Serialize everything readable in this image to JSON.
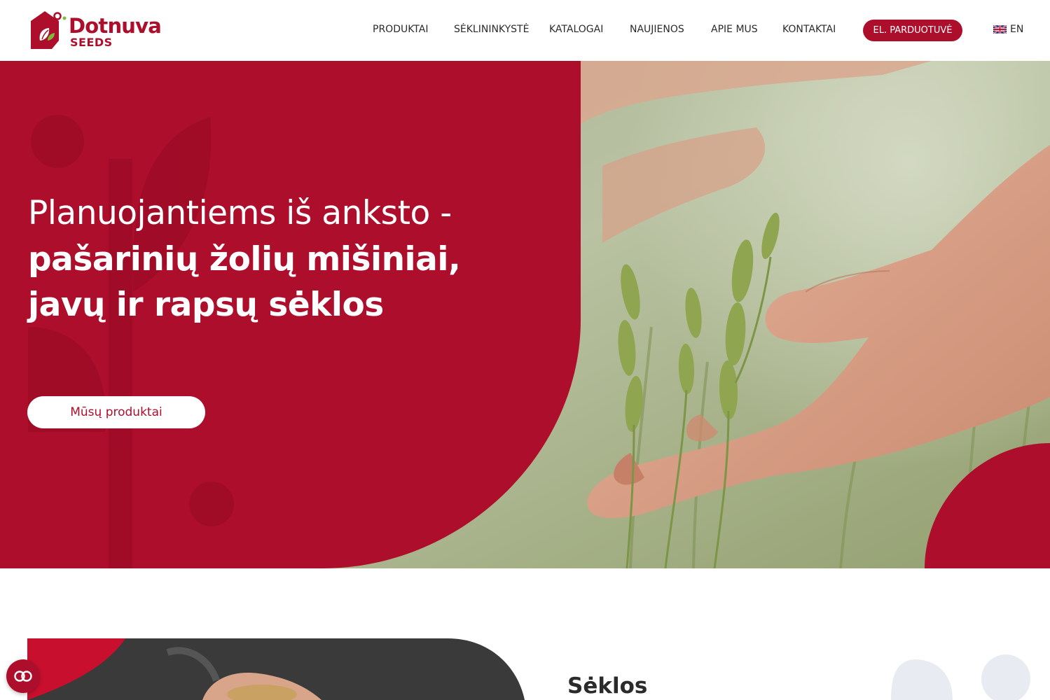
{
  "brand": {
    "name": "Dotnuva",
    "sub": "SEEDS",
    "accent_color": "#ad0e2b"
  },
  "nav": {
    "items": [
      {
        "label": "PRODUKTAI"
      },
      {
        "label": "SĖKLININKYSTĖ"
      },
      {
        "label": "KATALOGAI"
      },
      {
        "label": "NAUJIENOS"
      },
      {
        "label": "APIE MUS"
      },
      {
        "label": "KONTAKTAI"
      }
    ],
    "shop_button": "EL. PARDUOTUVĖ",
    "language": {
      "label": "EN",
      "icon": "uk-flag-icon"
    }
  },
  "hero": {
    "title_line1": "Planuojantiems iš anksto -",
    "title_line2": "pašarinių žolių mišiniai,",
    "title_line3": "javų ir rapsų sėklos",
    "cta": "Mūsų produktai",
    "image": "hands-touching-wheat-photo"
  },
  "section": {
    "title": "Sėklos",
    "image": "hands-holding-grain-photo"
  },
  "accessibility": {
    "icon": "accessibility-icon"
  }
}
